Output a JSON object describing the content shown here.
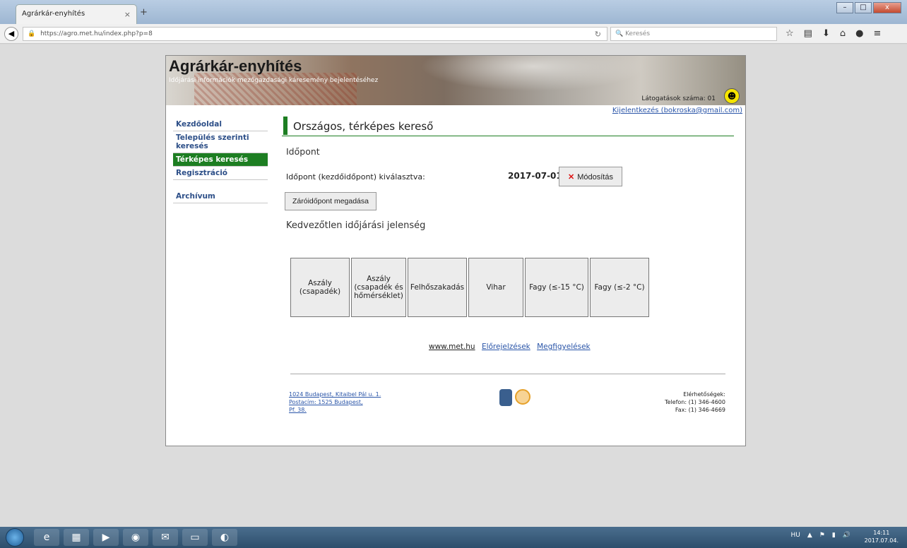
{
  "browser": {
    "tab_title": "Agrárkár-enyhítés",
    "tab_close": "×",
    "new_tab": "+",
    "url": "https://agro.met.hu/index.php?p=8",
    "search_placeholder": "Keresés",
    "window_controls": {
      "minimize": "–",
      "maximize": "□",
      "close": "x"
    }
  },
  "banner": {
    "title": "Agrárkár-enyhítés",
    "subtitle": "Időjárási információk mezőgazdasági káresemény bejelentéséhez",
    "visitors": "Látogatások száma: 01",
    "logout": "Kijelentkezés (bokroska@gmail.com)"
  },
  "sidebar": {
    "items": [
      {
        "label": "Kezdőoldal"
      },
      {
        "label": "Település szerinti keresés"
      },
      {
        "label": "Térképes keresés"
      },
      {
        "label": "Regisztráció"
      },
      {
        "label": "Archívum"
      }
    ]
  },
  "main": {
    "section_title": "Országos, térképes kereső",
    "time_heading": "Időpont",
    "time_label": "Időpont (kezdőidőpont) kiválasztva:",
    "date_value": "2017-07-01",
    "modify_button": "Módosítás",
    "end_button": "Záróidőpont megadása",
    "phenomenon_heading": "Kedvezőtlen időjárási jelenség",
    "phenomena": [
      "Aszály (csapadék)",
      "Aszály (csapadék és hőmérséklet)",
      "Felhőszakadás",
      "Vihar",
      "Fagy (≤-15 °C)",
      "Fagy (≤-2 °C)"
    ]
  },
  "footer": {
    "links": [
      "www.met.hu",
      "Előrejelzések",
      "Megfigyelések"
    ],
    "address_lines": [
      "1024 Budapest, Kitaibel Pál u. 1.",
      "Postacím: 1525 Budapest,",
      "Pf. 38."
    ],
    "contact_lines": [
      "Elérhetőségek:",
      "Telefon: (1) 346-4600",
      "Fax: (1) 346-4669"
    ]
  },
  "taskbar": {
    "language": "HU",
    "time": "14:11",
    "date": "2017.07.04."
  }
}
